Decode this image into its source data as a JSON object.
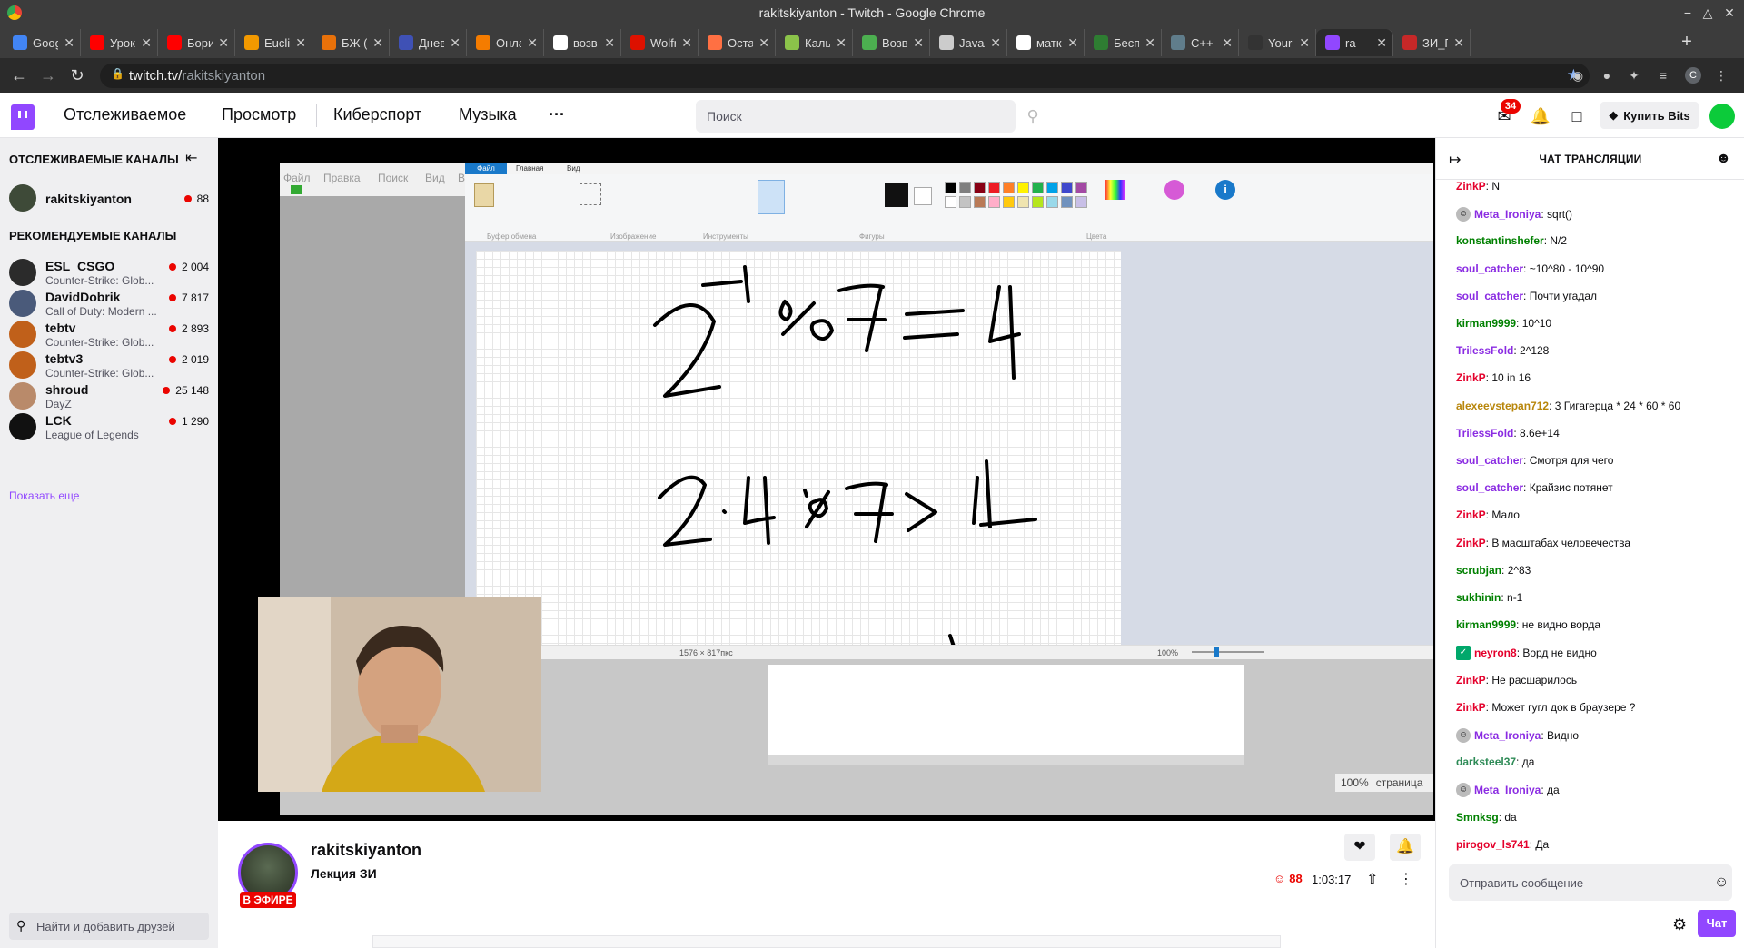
{
  "browser": {
    "window_title": "rakitskiyanton - Twitch - Google Chrome",
    "url_host": "twitch.tv/",
    "url_path": "rakitskiyanton",
    "tabs": [
      {
        "label": "Goog",
        "color": "#4285f4"
      },
      {
        "label": "Урок",
        "color": "#ff0000"
      },
      {
        "label": "Бори",
        "color": "#ff0000"
      },
      {
        "label": "Euclid",
        "color": "#f29900"
      },
      {
        "label": "БЖ (И",
        "color": "#e8710a"
      },
      {
        "label": "Днев",
        "color": "#3f51b5"
      },
      {
        "label": "Онла",
        "color": "#f57c00"
      },
      {
        "label": "возв",
        "color": "#ffffff"
      },
      {
        "label": "Wolfr",
        "color": "#dd1100"
      },
      {
        "label": "Оста",
        "color": "#ff7043"
      },
      {
        "label": "Каль",
        "color": "#8bc34a"
      },
      {
        "label": "Возв",
        "color": "#4caf50"
      },
      {
        "label": "Java/",
        "color": "#cccccc"
      },
      {
        "label": "матк",
        "color": "#ffffff"
      },
      {
        "label": "Бесп",
        "color": "#2e7d32"
      },
      {
        "label": "C++",
        "color": "#607d8b"
      },
      {
        "label": "Your",
        "color": "#333333"
      },
      {
        "label": "ra",
        "color": "#9147ff",
        "active": true
      },
      {
        "label": "ЗИ_Г",
        "color": "#c62828"
      }
    ]
  },
  "twitch_nav": {
    "following": "Отслеживаемое",
    "browse": "Просмотр",
    "esports": "Киберспорт",
    "music": "Музыка",
    "more": "···",
    "search_placeholder": "Поиск",
    "inbox_count": "34",
    "buy_bits": "Купить Bits"
  },
  "sidebar": {
    "followed_heading": "ОТСЛЕЖИВАЕМЫЕ КАНАЛЫ",
    "followed": [
      {
        "name": "rakitskiyanton",
        "game": "",
        "viewers": "88",
        "avatar_color": "#3e4a38"
      }
    ],
    "recommended_heading": "РЕКОМЕНДУЕМЫЕ КАНАЛЫ",
    "recommended": [
      {
        "name": "ESL_CSGO",
        "game": "Counter-Strike: Glob...",
        "viewers": "2 004",
        "avatar_color": "#2b2b2b"
      },
      {
        "name": "DavidDobrik",
        "game": "Call of Duty: Modern ...",
        "viewers": "7 817",
        "avatar_color": "#4a5a7a"
      },
      {
        "name": "tebtv",
        "game": "Counter-Strike: Glob...",
        "viewers": "2 893",
        "avatar_color": "#c0601a"
      },
      {
        "name": "tebtv3",
        "game": "Counter-Strike: Glob...",
        "viewers": "2 019",
        "avatar_color": "#c0601a"
      },
      {
        "name": "shroud",
        "game": "DayZ",
        "viewers": "25 148",
        "avatar_color": "#b98a6a"
      },
      {
        "name": "LCK",
        "game": "League of Legends",
        "viewers": "1 290",
        "avatar_color": "#111111"
      }
    ],
    "show_more": "Показать еще",
    "friends_placeholder": "Найти и добавить друзей"
  },
  "stream": {
    "paint": {
      "menu": [
        "Файл",
        "Правка",
        "Поиск",
        "Вид",
        "Вёрс"
      ],
      "ribbon_tabs": [
        "Файл",
        "Главная",
        "Вид"
      ],
      "groups": [
        "Буфер обмена",
        "Изображение",
        "Инструменты",
        "Фигуры",
        "Цвета"
      ],
      "dimensions": "1576 × 817пкс",
      "zoom": "100%"
    },
    "zoom_box": "100%",
    "zoom_box_label": "страница"
  },
  "info": {
    "streamer": "rakitskiyanton",
    "title": "Лекция ЗИ",
    "live": "В ЭФИРЕ",
    "viewers": "88",
    "uptime": "1:03:17"
  },
  "chat": {
    "header": "ЧАТ ТРАНСЛЯЦИИ",
    "input_placeholder": "Отправить сообщение",
    "chat_button": "Чат",
    "messages": [
      {
        "user": "ZinkP",
        "text": "N",
        "color": "#e4002b",
        "badge": ""
      },
      {
        "user": "Meta_Ironiya",
        "text": "sqrt()",
        "color": "#8a2be2",
        "badge": "avatar"
      },
      {
        "user": "konstantinshefer",
        "text": "N/2",
        "color": "#008000",
        "badge": ""
      },
      {
        "user": "soul_catcher",
        "text": "~10^80 - 10^90",
        "color": "#8a2be2",
        "badge": ""
      },
      {
        "user": "soul_catcher",
        "text": "Почти угадал",
        "color": "#8a2be2",
        "badge": ""
      },
      {
        "user": "kirman9999",
        "text": "10^10",
        "color": "#008000",
        "badge": ""
      },
      {
        "user": "TrilessFold",
        "text": "2^128",
        "color": "#8a2be2",
        "badge": ""
      },
      {
        "user": "ZinkP",
        "text": "10 in 16",
        "color": "#e4002b",
        "badge": ""
      },
      {
        "user": "alexeevstepan712",
        "text": "3 Гигагерца * 24 * 60 * 60",
        "color": "#b8860b",
        "badge": ""
      },
      {
        "user": "TrilessFold",
        "text": "8.6e+14",
        "color": "#8a2be2",
        "badge": ""
      },
      {
        "user": "soul_catcher",
        "text": "Смотря для чего",
        "color": "#8a2be2",
        "badge": ""
      },
      {
        "user": "soul_catcher",
        "text": "Крайзис потянет",
        "color": "#8a2be2",
        "badge": ""
      },
      {
        "user": "ZinkP",
        "text": "Мало",
        "color": "#e4002b",
        "badge": ""
      },
      {
        "user": "ZinkP",
        "text": "В масштабах человечества",
        "color": "#e4002b",
        "badge": ""
      },
      {
        "user": "scrubjan",
        "text": "2^83",
        "color": "#008000",
        "badge": ""
      },
      {
        "user": "sukhinin",
        "text": "n-1",
        "color": "#008000",
        "badge": ""
      },
      {
        "user": "kirman9999",
        "text": "не видно ворда",
        "color": "#008000",
        "badge": ""
      },
      {
        "user": "neyron8",
        "text": "Ворд не видно",
        "color": "#e4002b",
        "badge": "sub"
      },
      {
        "user": "ZinkP",
        "text": "Не расшарилось",
        "color": "#e4002b",
        "badge": ""
      },
      {
        "user": "ZinkP",
        "text": "Может гугл док в браузере ?",
        "color": "#e4002b",
        "badge": ""
      },
      {
        "user": "Meta_Ironiya",
        "text": "Видно",
        "color": "#8a2be2",
        "badge": "avatar"
      },
      {
        "user": "darksteel37",
        "text": "да",
        "color": "#2e8b57",
        "badge": ""
      },
      {
        "user": "Meta_Ironiya",
        "text": "да",
        "color": "#8a2be2",
        "badge": "avatar"
      },
      {
        "user": "Smnksg",
        "text": "da",
        "color": "#008000",
        "badge": ""
      },
      {
        "user": "pirogov_ls741",
        "text": "Да",
        "color": "#e4002b",
        "badge": ""
      }
    ]
  }
}
